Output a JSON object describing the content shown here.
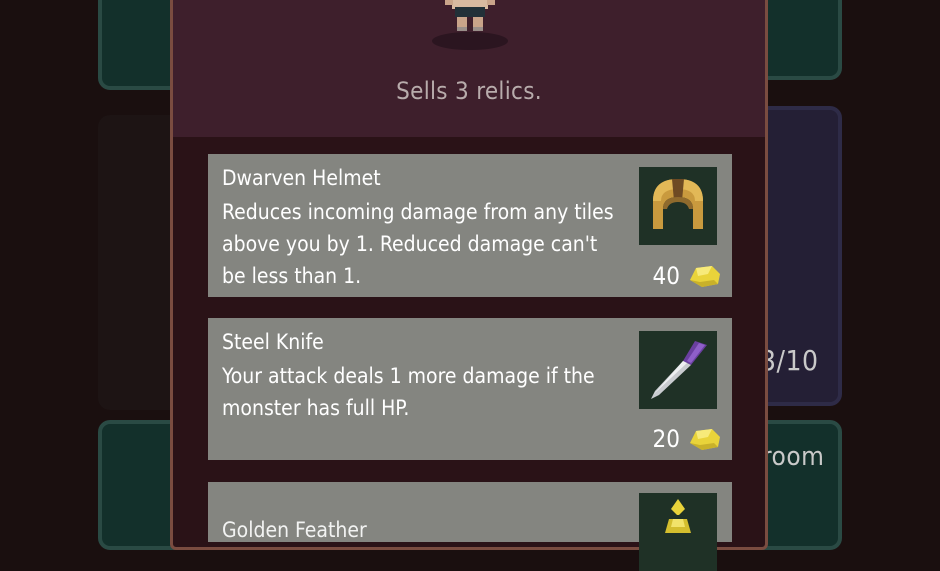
{
  "background": {
    "progress_text": "3/10",
    "room_text": "room"
  },
  "shop": {
    "subtitle": "Sells 3 relics.",
    "items": [
      {
        "name": "Dwarven Helmet",
        "description": "Reduces incoming damage from any tiles above you by 1. Reduced damage can't be less than 1.",
        "price": "40",
        "icon": "helmet-icon"
      },
      {
        "name": "Steel Knife",
        "description": "Your attack deals 1 more damage if the monster has full HP.",
        "price": "20",
        "icon": "knife-icon"
      },
      {
        "name": "Golden Feather",
        "description": "",
        "price": "",
        "icon": "golden-relic-icon"
      }
    ]
  },
  "colors": {
    "panel": "#2a1217",
    "header": "#3e1f2c",
    "item_bg": "#848580",
    "icon_bg": "#1f3126",
    "gold": "#e9d33a"
  }
}
